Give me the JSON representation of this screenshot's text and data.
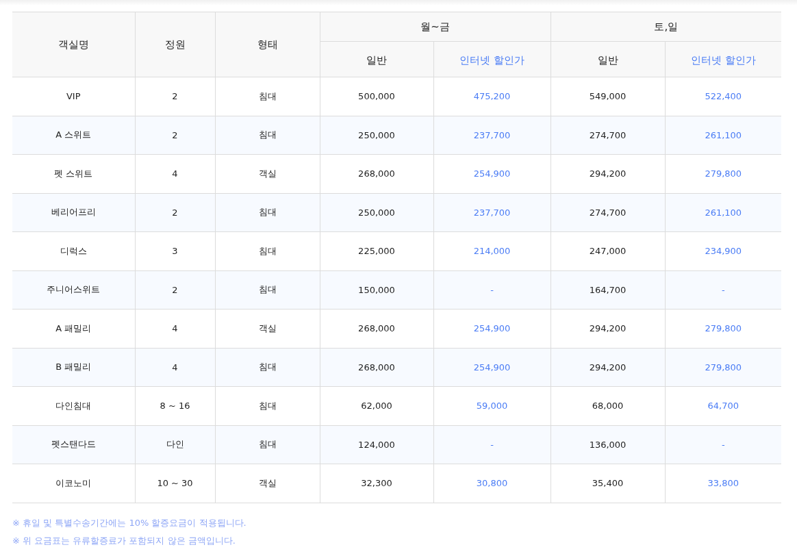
{
  "table": {
    "columns": [
      "객실명",
      "정원",
      "형태"
    ],
    "groups": [
      {
        "label": "월~금",
        "columns": [
          "일반",
          "인터넷 할인가"
        ]
      },
      {
        "label": "토,일",
        "columns": [
          "일반",
          "인터넷 할인가"
        ]
      }
    ],
    "rows": [
      {
        "name": "VIP",
        "capacity": "2",
        "type": "침대",
        "prices": [
          "500,000",
          "475,200",
          "549,000",
          "522,400"
        ]
      },
      {
        "name": "A 스위트",
        "capacity": "2",
        "type": "침대",
        "prices": [
          "250,000",
          "237,700",
          "274,700",
          "261,100"
        ]
      },
      {
        "name": "펫 스위트",
        "capacity": "4",
        "type": "객실",
        "prices": [
          "268,000",
          "254,900",
          "294,200",
          "279,800"
        ]
      },
      {
        "name": "베리어프리",
        "capacity": "2",
        "type": "침대",
        "prices": [
          "250,000",
          "237,700",
          "274,700",
          "261,100"
        ]
      },
      {
        "name": "디럭스",
        "capacity": "3",
        "type": "침대",
        "prices": [
          "225,000",
          "214,000",
          "247,000",
          "234,900"
        ]
      },
      {
        "name": "주니어스위트",
        "capacity": "2",
        "type": "침대",
        "prices": [
          "150,000",
          "-",
          "164,700",
          "-"
        ]
      },
      {
        "name": "A 패밀리",
        "capacity": "4",
        "type": "객실",
        "prices": [
          "268,000",
          "254,900",
          "294,200",
          "279,800"
        ]
      },
      {
        "name": "B 패밀리",
        "capacity": "4",
        "type": "침대",
        "prices": [
          "268,000",
          "254,900",
          "294,200",
          "279,800"
        ]
      },
      {
        "name": "다인침대",
        "capacity": "8 ~ 16",
        "type": "침대",
        "prices": [
          "62,000",
          "59,000",
          "68,000",
          "64,700"
        ]
      },
      {
        "name": "펫스탠다드",
        "capacity": "다인",
        "type": "침대",
        "prices": [
          "124,000",
          "-",
          "136,000",
          "-"
        ]
      },
      {
        "name": "이코노미",
        "capacity": "10 ~ 30",
        "type": "객실",
        "prices": [
          "32,300",
          "30,800",
          "35,400",
          "33,800"
        ]
      }
    ]
  },
  "notes": [
    "※ 휴일 및 특별수송기간에는 10% 할증요금이 적용됩니다.",
    "※ 위 요금표는 유류할증료가 포함되지 않은 금액입니다."
  ]
}
